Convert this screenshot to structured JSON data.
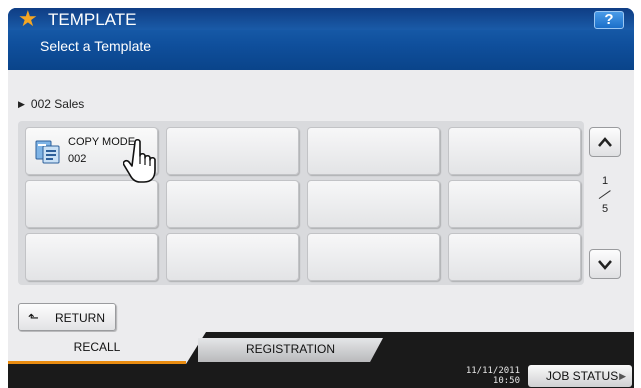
{
  "header": {
    "title": "TEMPLATE",
    "help_label": "?",
    "subtitle": "Select a Template"
  },
  "breadcrumb": {
    "label": "002 Sales"
  },
  "templates": [
    {
      "line1": "COPY MODE",
      "line2": "002",
      "icon": "copy-mode-icon"
    },
    {
      "line1": "",
      "line2": ""
    },
    {
      "line1": "",
      "line2": ""
    },
    {
      "line1": "",
      "line2": ""
    },
    {
      "line1": "",
      "line2": ""
    },
    {
      "line1": "",
      "line2": ""
    },
    {
      "line1": "",
      "line2": ""
    },
    {
      "line1": "",
      "line2": ""
    },
    {
      "line1": "",
      "line2": ""
    },
    {
      "line1": "",
      "line2": ""
    },
    {
      "line1": "",
      "line2": ""
    },
    {
      "line1": "",
      "line2": ""
    }
  ],
  "pager": {
    "current": "1",
    "total": "5"
  },
  "return_label": "RETURN",
  "tabs": {
    "recall": "RECALL",
    "registration": "REGISTRATION"
  },
  "status": {
    "date": "11/11/2011",
    "time": "10:50",
    "job_status": "JOB STATUS"
  },
  "colors": {
    "header_blue": "#0f4f9c",
    "star": "#f5a623",
    "tab_accent": "#e98c11"
  }
}
